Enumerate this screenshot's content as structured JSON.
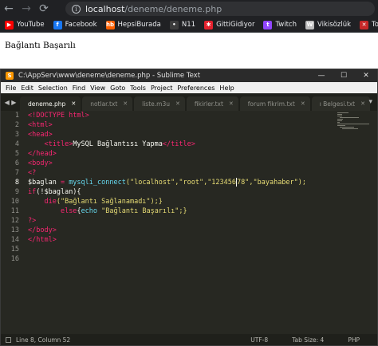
{
  "browser": {
    "url_host": "localhost",
    "url_path": "/deneme/deneme.php",
    "bookmarks": [
      {
        "label": "YouTube",
        "icon": "youtube-icon",
        "color": "#ff0000",
        "glyph": "▶"
      },
      {
        "label": "Facebook",
        "icon": "facebook-icon",
        "color": "#1877f2",
        "glyph": "f"
      },
      {
        "label": "HepsiBurada",
        "icon": "hepsiburada-icon",
        "color": "#ff6000",
        "glyph": "hb"
      },
      {
        "label": "N11",
        "icon": "n11-icon",
        "color": "#3c3c3c",
        "glyph": "•"
      },
      {
        "label": "GittiGidiyor",
        "icon": "gittigidiyor-icon",
        "color": "#e4222e",
        "glyph": "✱"
      },
      {
        "label": "Twitch",
        "icon": "twitch-icon",
        "color": "#9146ff",
        "glyph": "t"
      },
      {
        "label": "Vikisözlük",
        "icon": "wiki-icon",
        "color": "#bdbdbd",
        "glyph": "W"
      },
      {
        "label": "Torrent",
        "icon": "torrent-icon",
        "color": "#c62828",
        "glyph": "✕"
      }
    ]
  },
  "page": {
    "message": "Bağlantı Başarılı"
  },
  "editor": {
    "title": "C:\\AppServ\\www\\deneme\\deneme.php - Sublime Text",
    "menu": [
      "File",
      "Edit",
      "Selection",
      "Find",
      "View",
      "Goto",
      "Tools",
      "Project",
      "Preferences",
      "Help"
    ],
    "tabs": [
      {
        "label": "deneme.php",
        "active": true
      },
      {
        "label": "notlar.txt",
        "active": false
      },
      {
        "label": "liste.m3u",
        "active": false
      },
      {
        "label": "fikirler.txt",
        "active": false
      },
      {
        "label": "forum fikrim.txt",
        "active": false
      },
      {
        "label": "ı Belgesi.txt",
        "active": false
      }
    ],
    "line_numbers": [
      "1",
      "2",
      "3",
      "4",
      "5",
      "6",
      "7",
      "8",
      "9",
      "10",
      "11",
      "12",
      "13",
      "14",
      "15",
      "16"
    ],
    "current_line": 8,
    "code": {
      "l1_doctype": "<!DOCTYPE html>",
      "l2": "<html>",
      "l3": "<head>",
      "l4_open": "<title>",
      "l4_text": "MySQL Bağlantısı Yapma",
      "l4_close": "</title>",
      "l5": "</head>",
      "l6": "<body>",
      "l7": "<?",
      "l8_var": "$baglan",
      "l8_eq": " = ",
      "l8_fn": "mysqli_connect",
      "l8_args_a": "(\"localhost\",\"root\",\"123456",
      "l8_args_b": "78\",\"bayahaber\");",
      "l9_kw": "if",
      "l9_rest": "(!$baglan){",
      "l10_fn": "die",
      "l10_str": "(\"Bağlantı Sağlanamadı\");}",
      "l11_kw": "else",
      "l11_rest_a": "{",
      "l11_echo": "echo",
      "l11_str": " \"Bağlantı Başarılı\";}",
      "l12": "?>",
      "l13": "</body>",
      "l14": "</html>"
    },
    "status": {
      "position": "Line 8, Column 52",
      "encoding": "UTF-8",
      "tab_size": "Tab Size: 4",
      "syntax": "PHP"
    }
  }
}
